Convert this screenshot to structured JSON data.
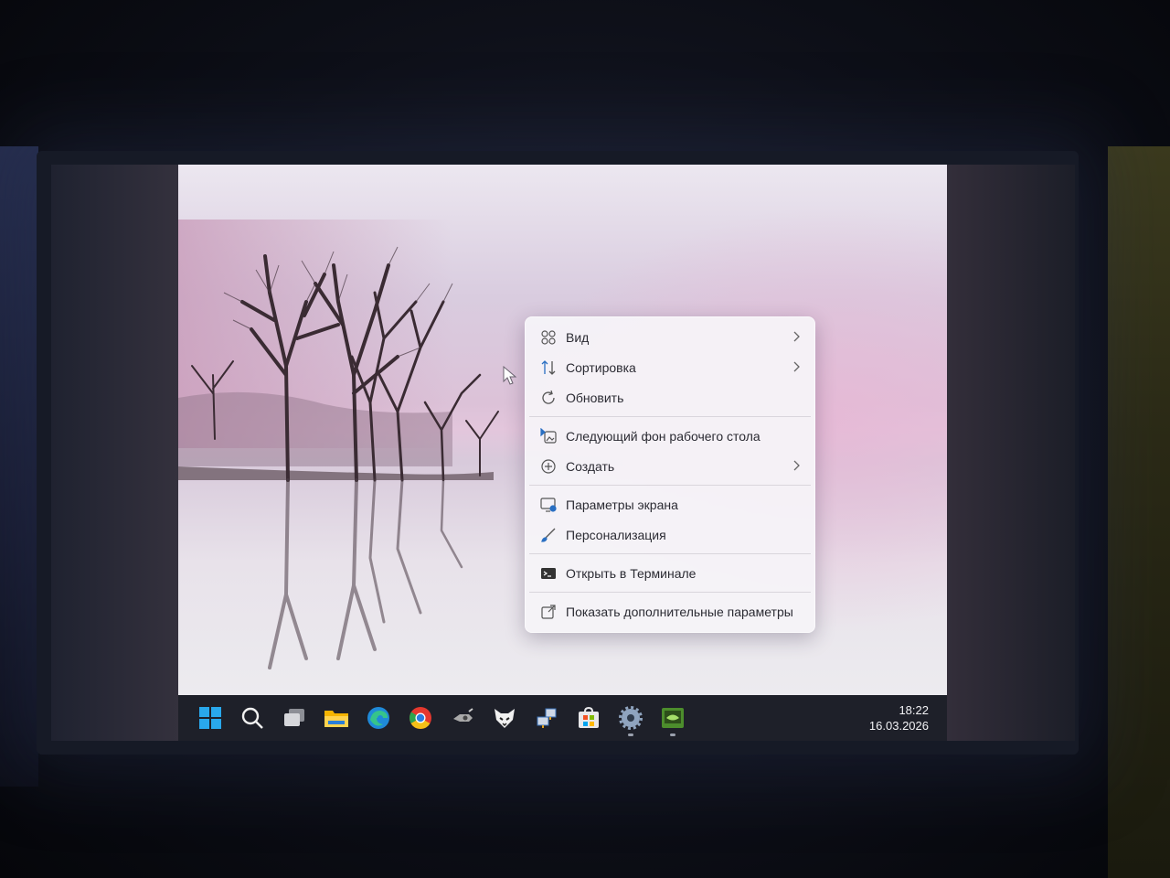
{
  "context_menu": {
    "items": [
      {
        "label": "Вид",
        "icon": "grid-icon",
        "submenu": true
      },
      {
        "label": "Сортировка",
        "icon": "sort-icon",
        "submenu": true
      },
      {
        "label": "Обновить",
        "icon": "refresh-icon",
        "submenu": false
      },
      {
        "label": "Следующий фон рабочего стола",
        "icon": "next-background-icon",
        "submenu": false
      },
      {
        "label": "Создать",
        "icon": "plus-circle-icon",
        "submenu": true
      },
      {
        "label": "Параметры экрана",
        "icon": "display-settings-icon",
        "submenu": false
      },
      {
        "label": "Персонализация",
        "icon": "brush-icon",
        "submenu": false
      },
      {
        "label": "Открыть в Терминале",
        "icon": "terminal-icon",
        "submenu": false
      },
      {
        "label": "Показать дополнительные параметры",
        "icon": "share-icon",
        "submenu": false
      }
    ]
  },
  "taskbar": {
    "icons": [
      "windows-start-icon",
      "search-icon",
      "task-view-icon",
      "file-explorer-icon",
      "edge-icon",
      "chrome-icon",
      "app-icon",
      "fox-app-icon",
      "network-app-icon",
      "store-icon",
      "settings-icon",
      "nvidia-icon"
    ],
    "time": "18:22",
    "date": "16.03.2026"
  },
  "colors": {
    "taskbar_bg": "#1e2029",
    "menu_bg": "#f6f3f8",
    "wallpaper_sky_top": "#d7cbe0",
    "wallpaper_horizon": "#e5c9de"
  }
}
